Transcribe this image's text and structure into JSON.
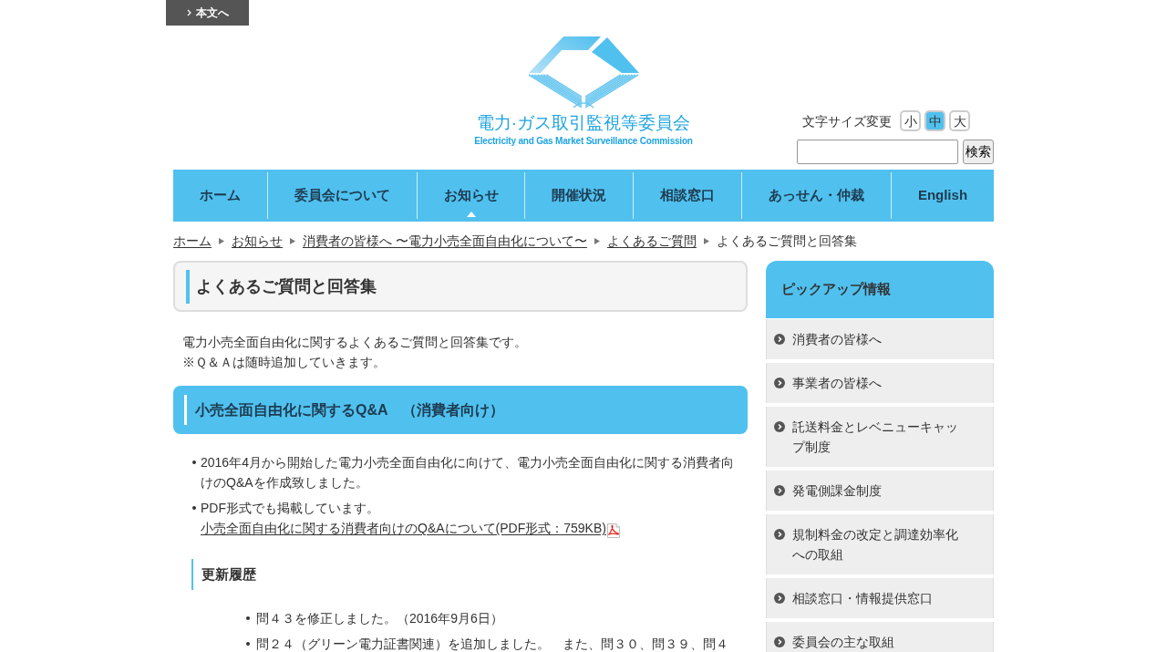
{
  "skip_link": {
    "label": "本文へ"
  },
  "logo": {
    "title": "電力·ガス取引監視等委員会",
    "subtitle": "Electricity and Gas Market Surveillance Commission"
  },
  "font_size": {
    "label": "文字サイズ変更",
    "options": [
      {
        "label": "小",
        "selected": false
      },
      {
        "label": "中",
        "selected": true
      },
      {
        "label": "大",
        "selected": false
      }
    ]
  },
  "search": {
    "button": "検索"
  },
  "nav": [
    {
      "label": "ホーム",
      "selected": false
    },
    {
      "label": "委員会について",
      "selected": false
    },
    {
      "label": "お知らせ",
      "selected": true
    },
    {
      "label": "開催状況",
      "selected": false
    },
    {
      "label": "相談窓口",
      "selected": false
    },
    {
      "label": "あっせん・仲裁",
      "selected": false
    },
    {
      "label": "English",
      "selected": false
    }
  ],
  "breadcrumb": [
    {
      "label": "ホーム",
      "kind": "link"
    },
    {
      "label": "お知らせ",
      "kind": "link"
    },
    {
      "label": "消費者の皆様へ 〜電力小売全面自由化について〜",
      "kind": "link"
    },
    {
      "label": "よくあるご質問",
      "kind": "link"
    },
    {
      "label": "よくあるご質問と回答集",
      "kind": "current"
    }
  ],
  "page_title": "よくあるご質問と回答集",
  "intro": [
    "電力小売全面自由化に関するよくあるご質問と回答集です。",
    "※Ｑ＆Ａは随時追加していきます。"
  ],
  "section": {
    "title": "小売全面自由化に関するQ&A　（消費者向け）",
    "bullets": [
      {
        "text": "2016年4月から開始した電力小売全面自由化に向けて、電力小売全面自由化に関する消費者向けのQ&Aを作成致しました。"
      },
      {
        "text": "PDF形式でも掲載しています。",
        "link": "小売全面自由化に関する消費者向けのQ&Aについて(PDF形式：759KB)"
      }
    ]
  },
  "history": {
    "title": "更新履歴",
    "items": [
      "問４３を修正しました。（2016年9月6日）",
      "問２４（グリーン電力証書関連）を追加しました。　また、問３０、問３９、問４"
    ]
  },
  "sidebar": {
    "title": "ピックアップ情報",
    "items": [
      "消費者の皆様へ",
      "事業者の皆様へ",
      "託送料金とレベニューキャップ制度",
      "発電側課金制度",
      "規制料金の改定と調達効率化への取組",
      "相談窓口・情報提供窓口",
      "委員会の主な取組"
    ]
  }
}
